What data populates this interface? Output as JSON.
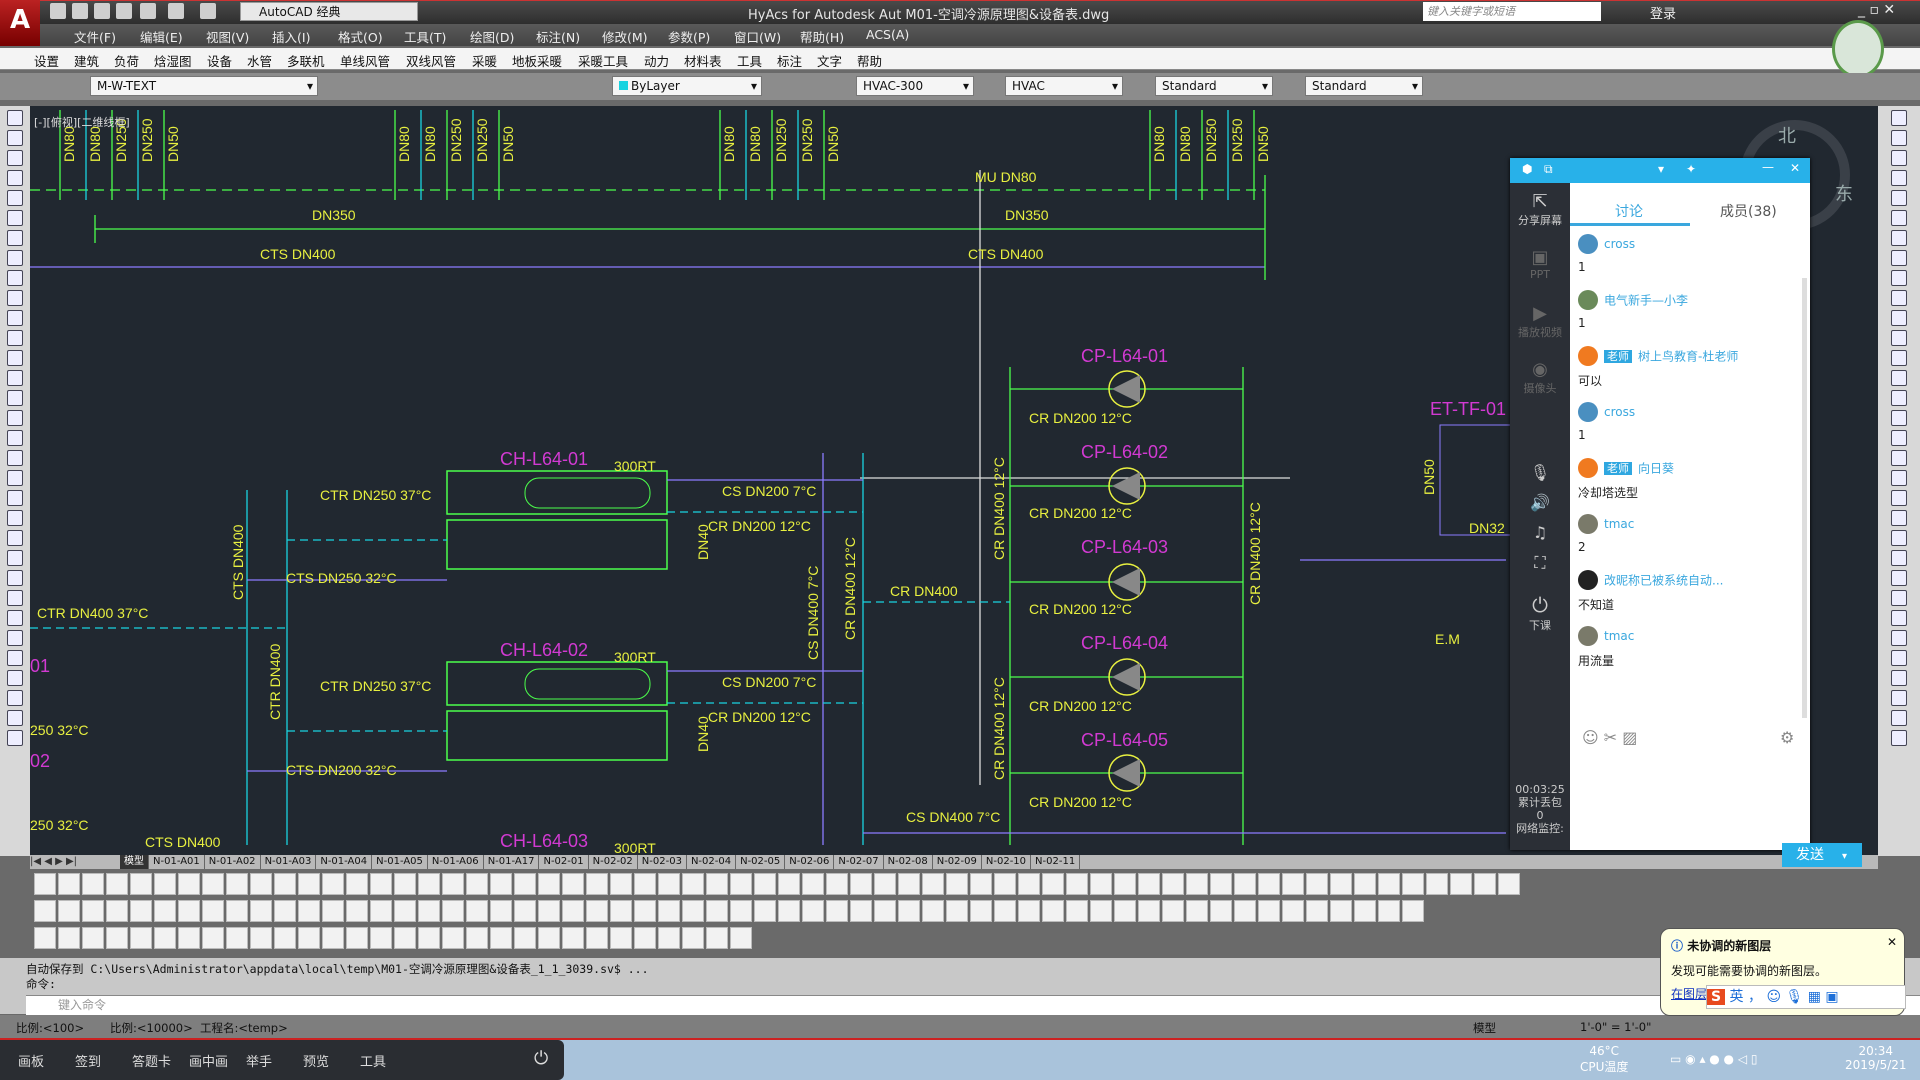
{
  "app": {
    "title": "HyAcs for Autodesk Aut    M01-空调冷源原理图&设备表.dwg",
    "logo": "A",
    "workspace": "AutoCAD 经典",
    "search_placeholder": "键入关键字或短语",
    "login": "登录"
  },
  "menus": [
    "文件(F)",
    "编辑(E)",
    "视图(V)",
    "插入(I)",
    "格式(O)",
    "工具(T)",
    "绘图(D)",
    "标注(N)",
    "修改(M)",
    "参数(P)",
    "窗口(W)",
    "帮助(H)",
    "ACS(A)"
  ],
  "hyacs_menus": [
    "设置",
    "建筑",
    "负荷",
    "焓湿图",
    "设备",
    "水管",
    "多联机",
    "单线风管",
    "双线风管",
    "采暖",
    "地板采暖",
    "采暖工具",
    "动力",
    "材料表",
    "工具",
    "标注",
    "文字",
    "帮助"
  ],
  "layer_toolbar": {
    "layer": "M-W-TEXT",
    "color": "ByLayer",
    "text_style": "HVAC-300",
    "dim_style": "HVAC",
    "table_style": "Standard",
    "mleader_style": "Standard"
  },
  "viewport_label": "[-][俯视][二维线框]",
  "compass": {
    "north": "北",
    "east": "东"
  },
  "drawing": {
    "top_branch_labels": [
      "DN80",
      "DN80",
      "DN250",
      "DN250",
      "DN50"
    ],
    "labels": [
      "CTS DN400",
      "CTS DN400",
      "DN350",
      "DN350",
      "MU DN80",
      "CH-L64-01",
      "300RT",
      "CTR DN250 37°C",
      "CS DN200 7°C",
      "CR DN200 12°C",
      "CTS DN250 32°C",
      "CTR DN400 37°C",
      "CH-L64-02",
      "300RT",
      "CTR DN250 37°C",
      "CS DN200 7°C",
      "CR DN200 12°C",
      "CTS DN200 32°C",
      "CTS DN400",
      "CH-L64-03",
      "300RT",
      "CR DN400",
      "CS DN400 7°C",
      "CP-L64-01",
      "CP-L64-02",
      "CP-L64-03",
      "CP-L64-04",
      "CP-L64-05",
      "CR DN200 12°C",
      "CR DN200 12°C",
      "CR DN200 12°C",
      "CR DN200 12°C",
      "CR DN200 12°C",
      "CTS DN400",
      "CTR DN400",
      "CS DN400 7°C",
      "CR DN400 12°C",
      "CR DN400 12°C",
      "CR DN400 12°C",
      "CR DN400 12°C",
      "ET-TF-01",
      "DN50",
      "DN32",
      "E.M",
      "250 32°C",
      "250 32°C",
      "DN40",
      "DN40",
      "01",
      "02"
    ],
    "colors": {
      "background": "#212830",
      "pipe_green": "#4cff4c",
      "pipe_cyan": "#19d3e0",
      "pipe_purple": "#8c7cff",
      "label_yellow": "#e8f040",
      "equipment_magenta": "#d23ad2"
    }
  },
  "layout_tabs": [
    "模型",
    "N-01-A01",
    "N-01-A02",
    "N-01-A03",
    "N-01-A04",
    "N-01-A05",
    "N-01-A06",
    "N-01-A17",
    "N-02-01",
    "N-02-02",
    "N-02-03",
    "N-02-04",
    "N-02-05",
    "N-02-06",
    "N-02-07",
    "N-02-08",
    "N-02-09",
    "N-02-10",
    "N-02-11"
  ],
  "command": {
    "history_1": "自动保存到 C:\\Users\\Administrator\\appdata\\local\\temp\\M01-空调冷源原理图&设备表_1_1_3039.sv$ ...",
    "history_2": "命令:",
    "placeholder": "键入命令"
  },
  "statusbar": {
    "scale_1": "比例:<100>",
    "scale_2": "比例:<10000>",
    "project": "工程名:<temp>",
    "model": "模型",
    "annotation_scale": "1'-0\" = 1'-0\""
  },
  "chat": {
    "side": {
      "share": "分享屏幕",
      "ppt": "PPT",
      "video": "播放视频",
      "camera": "摄像头",
      "end_class": "下课",
      "timer": "00:03:25",
      "packet_loss_label": "累计丢包",
      "packet_loss": "0",
      "network": "网络监控:"
    },
    "tabs": [
      "讨论",
      "成员(38)"
    ],
    "messages": [
      {
        "name": "cross",
        "text": "1",
        "teacher": false,
        "avatar": "#4a8fc0"
      },
      {
        "name": "电气新手—小李",
        "text": "1",
        "teacher": false,
        "avatar": "#6a8a5a"
      },
      {
        "name": "树上鸟教育-杜老师",
        "text": "可以",
        "teacher": true,
        "avatar": "#f07a20"
      },
      {
        "name": "cross",
        "text": "1",
        "teacher": false,
        "avatar": "#4a8fc0"
      },
      {
        "name": "向日葵",
        "text": "冷却塔选型",
        "teacher": true,
        "avatar": "#f07a20"
      },
      {
        "name": "tmac",
        "text": "2",
        "teacher": false,
        "avatar": "#7a7a6a"
      },
      {
        "name": "改昵称已被系统自动...",
        "text": "不知道",
        "teacher": false,
        "avatar": "#222"
      },
      {
        "name": "tmac",
        "text": "用流量",
        "teacher": false,
        "avatar": "#7a7a6a"
      }
    ],
    "teacher_badge": "老师",
    "send": "发送"
  },
  "notification": {
    "title": "未协调的新图层",
    "body": "发现可能需要协调的新图层。",
    "link": "在图层..."
  },
  "ime": {
    "mode": "英"
  },
  "classbar": [
    "画板",
    "签到",
    "答题卡",
    "画中画",
    "举手",
    "预览",
    "工具"
  ],
  "tray": {
    "temp": "46°C",
    "temp_label": "CPU温度",
    "time": "20:34",
    "date": "2019/5/21"
  }
}
